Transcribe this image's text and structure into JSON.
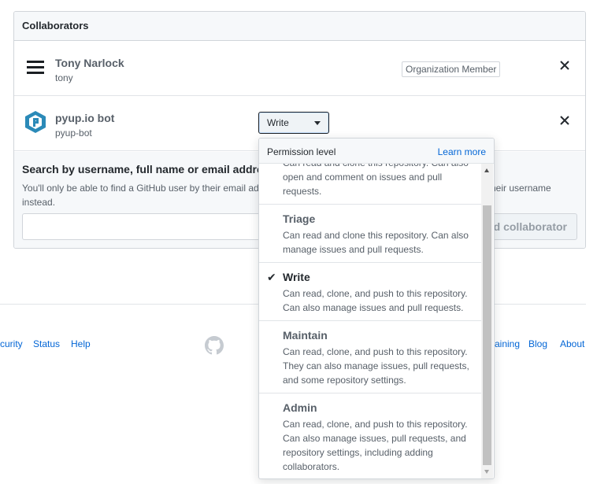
{
  "collaborators": {
    "header": "Collaborators",
    "rows": [
      {
        "name": "Tony Narlock",
        "login": "tony",
        "badge": "Organization Member"
      },
      {
        "name": "pyup.io bot",
        "login": "pyup-bot",
        "permission": "Write"
      }
    ]
  },
  "search": {
    "title": "Search by username, full name or email address",
    "note_line1_left": "You'll only be able to find a GitHub user by their email ad",
    "note_line1_right": "heir username",
    "note_line2": "instead.",
    "add_button": "ld collaborator"
  },
  "footer": {
    "links_left": [
      "curity",
      "Status",
      "Help"
    ],
    "links_right": [
      "aining",
      "Blog",
      "About"
    ]
  },
  "permission_menu": {
    "title": "Permission level",
    "learn_more": "Learn more",
    "partial_item": {
      "desc_line1": "Can read and clone this repository. Can also",
      "desc_line2": "open and comment on issues and pull",
      "desc_line3": "requests."
    },
    "items": [
      {
        "title": "Triage",
        "desc": [
          "Can read and clone this repository. Can also",
          "manage issues and pull requests."
        ],
        "selected": false
      },
      {
        "title": "Write",
        "desc": [
          "Can read, clone, and push to this repository.",
          "Can also manage issues and pull requests."
        ],
        "selected": true
      },
      {
        "title": "Maintain",
        "desc": [
          "Can read, clone, and push to this repository.",
          "They can also manage issues, pull requests,",
          "and some repository settings."
        ],
        "selected": false
      },
      {
        "title": "Admin",
        "desc": [
          "Can read, clone, and push to this repository.",
          "Can also manage issues, pull requests, and",
          "repository settings, including adding",
          "collaborators."
        ],
        "selected": false
      }
    ],
    "check_glyph": "✔"
  },
  "colors": {
    "link": "#0366d6",
    "border": "#d1d5da",
    "muted_text": "#586069",
    "pyup_blue": "#2b8ab8"
  }
}
